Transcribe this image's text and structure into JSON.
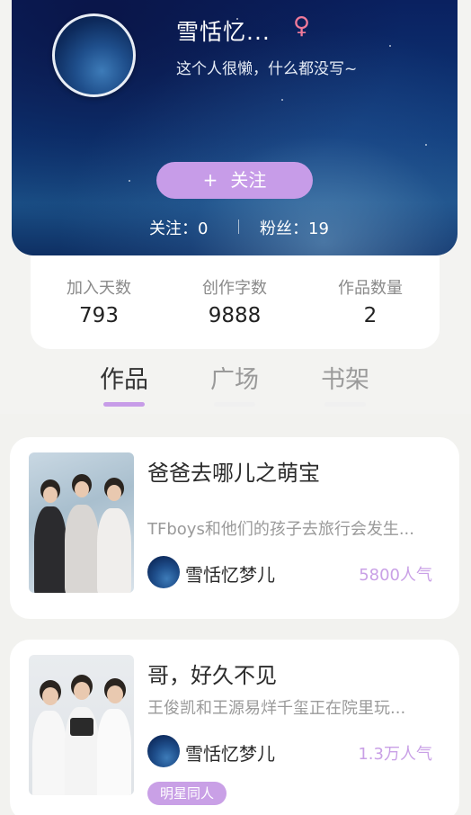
{
  "profile": {
    "name": "雪恬忆...",
    "gender_symbol": "♀",
    "bio": "这个人很懒，什么都没写~",
    "follow_label": "关注",
    "follow_plus": "+",
    "following_text": "关注：0",
    "fans_text": "粉丝：19"
  },
  "stats": [
    {
      "label": "加入天数",
      "value": "793"
    },
    {
      "label": "创作字数",
      "value": "9888"
    },
    {
      "label": "作品数量",
      "value": "2"
    }
  ],
  "tabs": [
    {
      "label": "作品",
      "active": true
    },
    {
      "label": "广场",
      "active": false
    },
    {
      "label": "书架",
      "active": false
    }
  ],
  "works": [
    {
      "title": "爸爸去哪儿之萌宝",
      "description": "TFboys和他们的孩子去旅行会发生...",
      "author": "雪恬忆梦儿",
      "popularity": "5800人气"
    },
    {
      "title": "哥，好久不见",
      "description": "王俊凯和王源易烊千玺正在院里玩...",
      "author": "雪恬忆梦儿",
      "popularity": "1.3万人气",
      "tag": "明星同人"
    }
  ],
  "colors": {
    "accent": "#c79ce8",
    "popularity": "#c9a0e6",
    "gender": "#f07a9a",
    "banner_dark": "#0a1f5e"
  }
}
